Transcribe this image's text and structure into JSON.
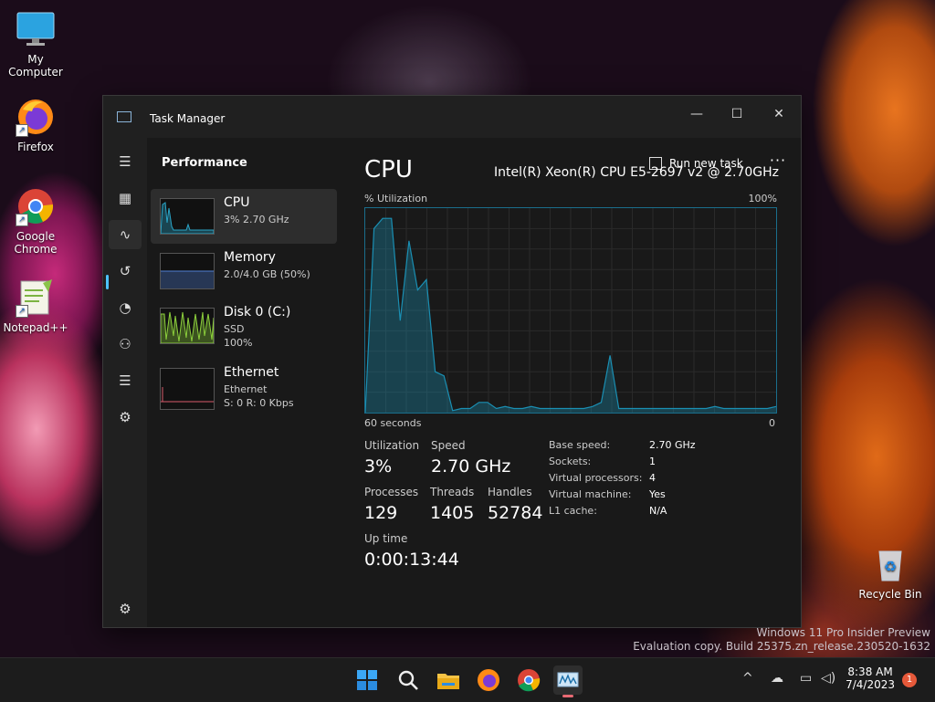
{
  "desktop": {
    "icons": [
      {
        "label": "My Computer"
      },
      {
        "label": "Firefox"
      },
      {
        "label": "Google Chrome"
      },
      {
        "label": "Notepad++"
      },
      {
        "label": "Recycle Bin"
      }
    ],
    "watermark": {
      "line1": "Windows 11 Pro Insider Preview",
      "line2": "Evaluation copy. Build 25375.zn_release.230520-1632"
    }
  },
  "window": {
    "title": "Task Manager",
    "controls": {
      "minimize": "—",
      "maximize": "☐",
      "close": "✕"
    }
  },
  "sidebar": {
    "items": [
      {
        "name": "hamburger-menu",
        "icon": "☰"
      },
      {
        "name": "processes",
        "icon": "▦"
      },
      {
        "name": "performance",
        "icon": "∿"
      },
      {
        "name": "app-history",
        "icon": "↺"
      },
      {
        "name": "startup-apps",
        "icon": "◔"
      },
      {
        "name": "users",
        "icon": "⚇"
      },
      {
        "name": "details",
        "icon": "☰"
      },
      {
        "name": "services",
        "icon": "⚙"
      },
      {
        "name": "settings",
        "icon": "⚙"
      }
    ]
  },
  "header": {
    "title": "Performance",
    "run_new_task": "Run new task",
    "more": "···"
  },
  "resources": [
    {
      "name": "CPU",
      "sub1": "3% 2.70 GHz",
      "sub2": "",
      "color": "#2aa5c8"
    },
    {
      "name": "Memory",
      "sub1": "2.0/4.0 GB (50%)",
      "sub2": "",
      "color": "#4f7fd4"
    },
    {
      "name": "Disk 0 (C:)",
      "sub1": "SSD",
      "sub2": "100%",
      "color": "#8ccf3c"
    },
    {
      "name": "Ethernet",
      "sub1": "Ethernet",
      "sub2": "S: 0 R: 0 Kbps",
      "color": "#d85a6a"
    }
  ],
  "cpu": {
    "title": "CPU",
    "model": "Intel(R) Xeon(R) CPU E5-2697 v2 @ 2.70GHz",
    "graph": {
      "ylabel": "% Utilization",
      "ymax_label": "100%",
      "xlabel": "60 seconds",
      "xmin_label": "0",
      "color": "#1a8fb3",
      "utilization": [
        0,
        90,
        95,
        95,
        45,
        84,
        60,
        65,
        20,
        18,
        1,
        2,
        2,
        5,
        5,
        2,
        3,
        2,
        2,
        3,
        2,
        2,
        2,
        2,
        2,
        2,
        3,
        5,
        28,
        2,
        2,
        2,
        2,
        2,
        2,
        2,
        2,
        2,
        2,
        2,
        3,
        2,
        2,
        2,
        2,
        2,
        2,
        3
      ]
    },
    "stats": {
      "utilization_label": "Utilization",
      "utilization": "3%",
      "speed_label": "Speed",
      "speed": "2.70 GHz",
      "processes_label": "Processes",
      "processes": "129",
      "threads_label": "Threads",
      "threads": "1405",
      "handles_label": "Handles",
      "handles": "52784",
      "uptime_label": "Up time",
      "uptime": "0:00:13:44"
    },
    "info": [
      {
        "key": "Base speed:",
        "value": "2.70 GHz"
      },
      {
        "key": "Sockets:",
        "value": "1"
      },
      {
        "key": "Virtual processors:",
        "value": "4"
      },
      {
        "key": "Virtual machine:",
        "value": "Yes"
      },
      {
        "key": "L1 cache:",
        "value": "N/A"
      }
    ]
  },
  "taskbar": {
    "apps": [
      {
        "name": "start-button",
        "icon": "windows-logo"
      },
      {
        "name": "search-button",
        "icon": "magnifier"
      },
      {
        "name": "file-explorer",
        "icon": "folder"
      },
      {
        "name": "firefox",
        "icon": "firefox"
      },
      {
        "name": "chrome",
        "icon": "chrome"
      },
      {
        "name": "task-manager",
        "icon": "task-manager"
      }
    ],
    "tray": {
      "chevron": "^"
    },
    "time": "8:38 AM",
    "date": "7/4/2023",
    "notifications": "1"
  }
}
